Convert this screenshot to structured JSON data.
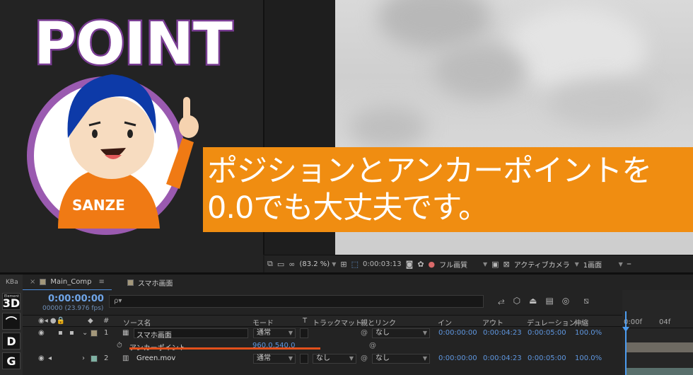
{
  "overlay": {
    "logo_text": "POINT",
    "mascot_shirt_text": "SANZE",
    "caption_line1": "ポジションとアンカーポイントを",
    "caption_line2": "0.0でも大丈夫です。"
  },
  "viewer_toolbar": {
    "zoom": "(83.2 %)",
    "timecode": "0:00:03:13",
    "resolution": "フル画質",
    "camera": "アクティブカメラ",
    "views": "1画面"
  },
  "left_tools": {
    "label": "KBa",
    "buttons": [
      {
        "label": "3D",
        "sub": "Element"
      },
      {
        "label": "⌒",
        "sub": ""
      },
      {
        "label": "D",
        "sub": ""
      },
      {
        "label": "G",
        "sub": ""
      }
    ]
  },
  "tabs": [
    {
      "label": "Main_Comp",
      "menu": "≡"
    },
    {
      "label": "スマホ画面"
    }
  ],
  "timecode": {
    "main": "0:00:00:00",
    "sub": "00000 (23.976 fps)",
    "search_placeholder": "ρ▾"
  },
  "columns": {
    "number": "#",
    "source_name": "ソース名",
    "mode": "モード",
    "t": "T",
    "track_matte": "トラックマット",
    "parent_link": "親とリンク",
    "in": "イン",
    "out": "アウト",
    "duration": "デュレーション",
    "stretch": "伸縮"
  },
  "layers": [
    {
      "num": "1",
      "name": "スマホ画面",
      "mode": "通常",
      "parent": "なし",
      "in": "0:00:00:00",
      "out": "0:00:04:23",
      "duration": "0:00:05:00",
      "stretch": "100.0%",
      "color": "#a3977a"
    },
    {
      "num": "2",
      "name": "Green.mov",
      "mode": "通常",
      "matte": "なし",
      "parent": "なし",
      "in": "0:00:00:00",
      "out": "0:00:04:23",
      "duration": "0:00:05:00",
      "stretch": "100.0%",
      "color": "#7fb1a3"
    }
  ],
  "property": {
    "name": "アンカーポイント",
    "value": "960.0,540.0"
  },
  "ruler": {
    "start": "0:00f",
    "mark": "04f"
  },
  "colors": {
    "caption_bg": "#f08d11",
    "timecode_blue": "#6fa5e8",
    "underline": "#e2501c",
    "logo_outline": "#7a3d94"
  }
}
